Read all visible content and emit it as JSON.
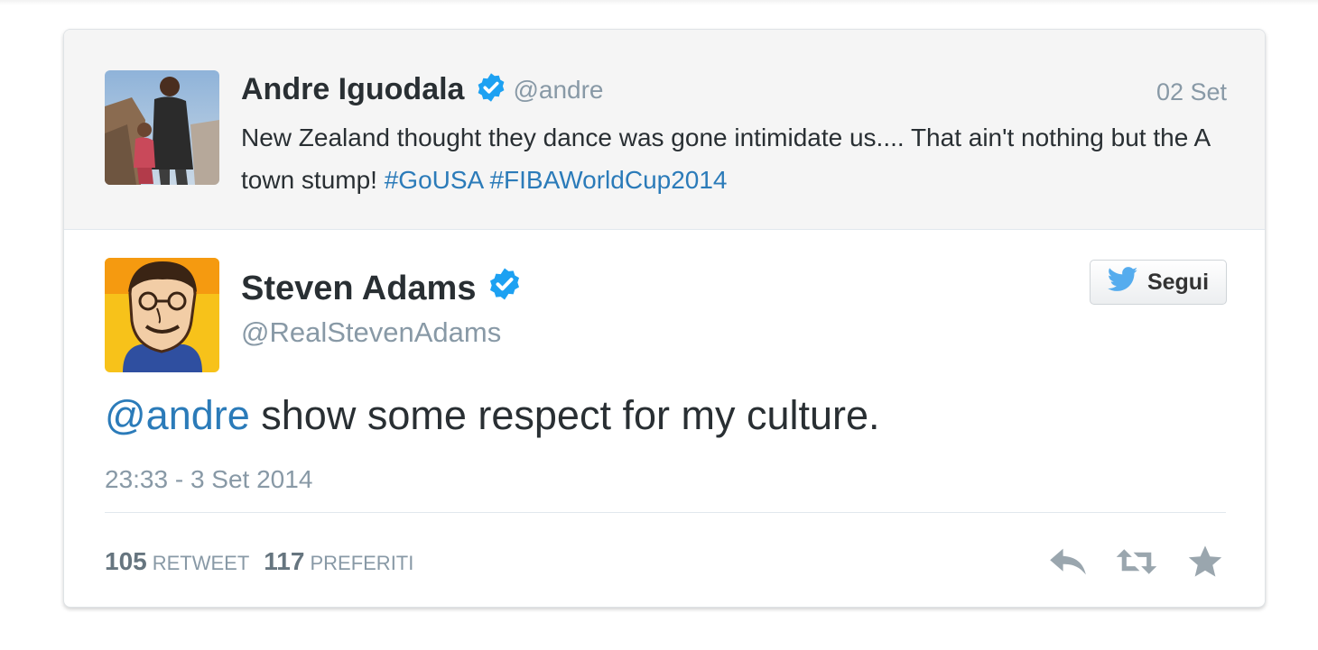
{
  "parent_tweet": {
    "author_name": "Andre Iguodala",
    "handle": "@andre",
    "date": "02 Set",
    "text_plain": "New Zealand thought they dance was gone intimidate us.... That ain't nothing but the A town stump! ",
    "hashtags": [
      "#GoUSA",
      "#FIBAWorldCup2014"
    ],
    "verified": true
  },
  "tweet": {
    "author_name": "Steven Adams",
    "handle": "@RealStevenAdams",
    "verified": true,
    "mention": "@andre",
    "text": " show some respect for my culture.",
    "timestamp": "23:33 - 3 Set 2014",
    "retweet_count": "105",
    "retweet_label": "RETWEET",
    "favorite_count": "117",
    "favorite_label": "PREFERITI"
  },
  "follow_button": {
    "label": "Segui",
    "icon": "twitter-bird-icon"
  },
  "actions": [
    {
      "name": "reply",
      "icon": "reply-icon"
    },
    {
      "name": "retweet",
      "icon": "retweet-icon"
    },
    {
      "name": "favorite",
      "icon": "star-icon"
    }
  ],
  "colors": {
    "link": "#2b7bb9",
    "verified_badge": "#1da1f2",
    "muted_text": "#8899a6",
    "twitter_blue": "#55acee"
  }
}
